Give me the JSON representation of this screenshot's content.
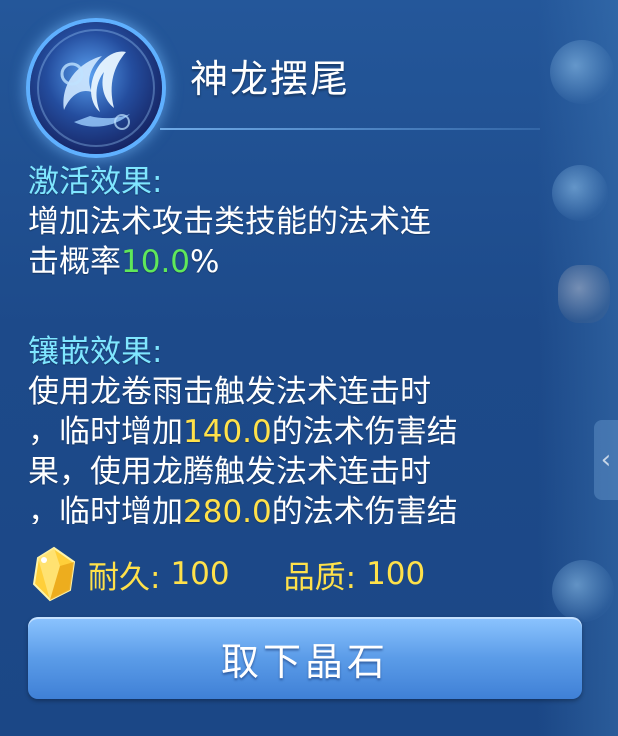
{
  "skill": {
    "name": "神龙摆尾",
    "icon": "dragon-tail-skill-icon"
  },
  "activation": {
    "title": "激活效果:",
    "lines": [
      {
        "parts": [
          {
            "text": "增加法术攻击类技能的法术连",
            "color": "white"
          }
        ]
      },
      {
        "parts": [
          {
            "text": "击概率",
            "color": "white"
          },
          {
            "text": "10.0",
            "color": "green"
          },
          {
            "text": "%",
            "color": "white"
          }
        ]
      }
    ]
  },
  "inlay": {
    "title": "镶嵌效果:",
    "lines": [
      {
        "parts": [
          {
            "text": "使用龙卷雨击触发法术连击时",
            "color": "white"
          }
        ]
      },
      {
        "parts": [
          {
            "text": "，临时增加",
            "color": "white"
          },
          {
            "text": "140.0",
            "color": "yellow"
          },
          {
            "text": "的法术伤害结",
            "color": "white"
          }
        ]
      },
      {
        "parts": [
          {
            "text": "果，使用龙腾触发法术连击时",
            "color": "white"
          }
        ]
      },
      {
        "parts": [
          {
            "text": "，临时增加",
            "color": "white"
          },
          {
            "text": "280.0",
            "color": "yellow"
          },
          {
            "text": "的法术伤害结",
            "color": "white"
          }
        ]
      }
    ]
  },
  "stats": {
    "icon": "crystal-icon",
    "durability_label": "耐久:",
    "durability_value": "100",
    "quality_label": "品质:",
    "quality_value": "100"
  },
  "button": {
    "label": "取下晶石"
  },
  "colors": {
    "section_title": "#7fe6ff",
    "highlight_green": "#5fe85a",
    "highlight_yellow": "#ffe14a",
    "panel_bg": "#1f4a86",
    "button": "#5b9ce8"
  }
}
